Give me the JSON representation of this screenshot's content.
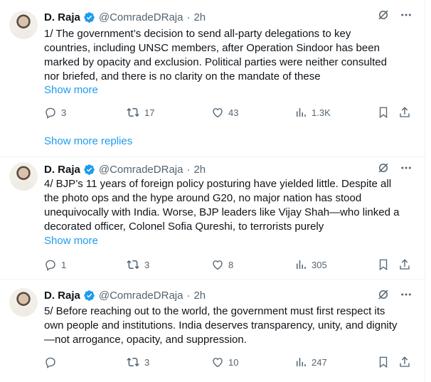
{
  "tweets": [
    {
      "author_name": "D. Raja",
      "handle": "@ComradeDRaja",
      "time": "2h",
      "lines": [
        "1/ The government’s decision to send all-party delegations to key",
        "countries, including UNSC members, after Operation Sindoor has been",
        "marked by opacity and exclusion. Political parties were neither consulted",
        "nor briefed, and there is no clarity on the mandate of these"
      ],
      "show_more": "Show more",
      "replies": "3",
      "reposts": "17",
      "likes": "43",
      "views": "1.3K"
    },
    {
      "author_name": "D. Raja",
      "handle": "@ComradeDRaja",
      "time": "2h",
      "lines": [
        "4/ BJP’s 11 years of foreign policy posturing have yielded little. Despite all",
        "the photo ops and the hype around G20, no major nation has stood",
        "unequivocally with India. Worse, BJP leaders like Vijay Shah—who linked a",
        "decorated officer, Colonel Sofia Qureshi, to terrorists purely"
      ],
      "show_more": "Show more",
      "replies": "1",
      "reposts": "3",
      "likes": "8",
      "views": "305"
    },
    {
      "author_name": "D. Raja",
      "handle": "@ComradeDRaja",
      "time": "2h",
      "lines": [
        "5/ Before reaching out to the world, the government must first respect its",
        "own people and institutions. India deserves transparency, unity, and dignity",
        "—not arrogance, opacity, and suppression."
      ],
      "show_more": "",
      "replies": "",
      "reposts": "3",
      "likes": "10",
      "views": "247"
    }
  ],
  "show_more_replies": "Show more replies",
  "colors": {
    "accent": "#1d9bf0",
    "secondary_text": "#536471",
    "text": "#0f1419"
  }
}
